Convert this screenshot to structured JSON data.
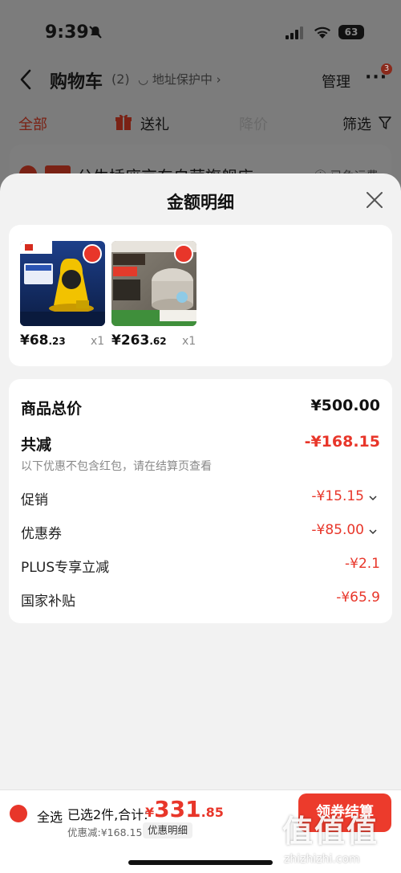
{
  "status_bar": {
    "time": "9:39",
    "battery": "63"
  },
  "nav": {
    "title": "购物车",
    "count": "(2)",
    "address_protect": "地址保护中 ›",
    "manage": "管理",
    "more_badge": "3"
  },
  "filter_tabs": {
    "all": "全部",
    "gift": "送礼",
    "price_drop": "降价",
    "filter": "筛选"
  },
  "store": {
    "name": "公牛插座京东自营旗舰店 ›",
    "freight": "ⓘ 已免运费"
  },
  "sheet": {
    "title": "金额明细",
    "products": [
      {
        "price_int": "¥68",
        "price_dec": ".23",
        "qty": "x1"
      },
      {
        "price_int": "¥263",
        "price_dec": ".62",
        "qty": "x1"
      }
    ],
    "details": {
      "total_label": "商品总价",
      "total_value": "¥500.00",
      "reduce_label": "共减",
      "reduce_value": "-¥168.15",
      "note": "以下优惠不包含红包，请在结算页查看",
      "promo_label": "促销",
      "promo_value": "-¥15.15",
      "coupon_label": "优惠券",
      "coupon_value": "-¥85.00",
      "plus_label": "PLUS专享立减",
      "plus_value": "-¥2.1",
      "subsidy_label": "国家补贴",
      "subsidy_value": "-¥65.9"
    }
  },
  "bottom": {
    "select_all": "全选",
    "selected": "已选2件,合计:",
    "total_symbol": "¥",
    "total_int": "331",
    "total_dec": ".85",
    "discount": "优惠减:¥168.15",
    "discount_detail": "优惠明细",
    "checkout": "领券结算"
  },
  "watermark": {
    "logo": "值值值",
    "url": "zhizhizhi.com"
  },
  "colors": {
    "accent": "#e8362a",
    "sheet_bg": "#f2f2f2",
    "dim_bg": "#7c7c7c"
  }
}
